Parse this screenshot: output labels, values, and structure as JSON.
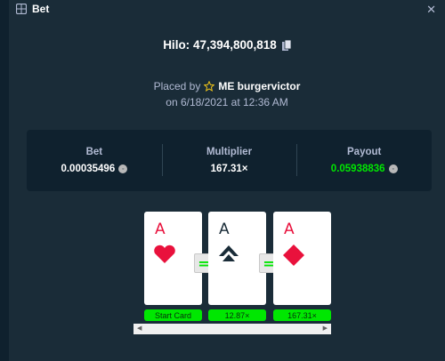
{
  "header": {
    "title": "Bet",
    "close_label": "✕"
  },
  "game": {
    "name_label": "Hilo:",
    "bet_id": "47,394,800,818"
  },
  "placed": {
    "prefix": "Placed by",
    "username": "ME burgervictor",
    "date": "on 6/18/2021 at 12:36 AM"
  },
  "stats": {
    "bet": {
      "label": "Bet",
      "value": "0.00035496"
    },
    "multiplier": {
      "label": "Multiplier",
      "value": "167.31×"
    },
    "payout": {
      "label": "Payout",
      "value": "0.05938836"
    }
  },
  "cards": [
    {
      "rank": "A",
      "suit": "hearts",
      "color": "#e9113c",
      "tag": "Start Card"
    },
    {
      "rank": "A",
      "suit": "spades",
      "color": "#1a2c38",
      "tag": "12.87×"
    },
    {
      "rank": "A",
      "suit": "diamonds",
      "color": "#e9113c",
      "tag": "167.31×"
    }
  ],
  "equals_symbol": "=",
  "coin_icon": "coin-icon",
  "colors": {
    "background": "#1a2c38",
    "panel": "#0f212e",
    "green": "#00e701",
    "red": "#e9113c"
  }
}
